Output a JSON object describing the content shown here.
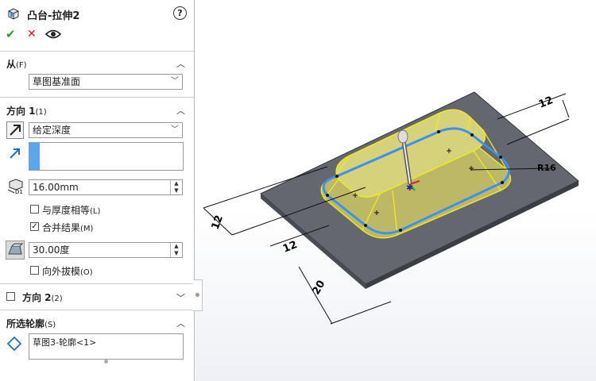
{
  "feature": {
    "title": "凸台-拉伸2",
    "help": "?"
  },
  "actions": {
    "ok": "✔",
    "cancel": "✕",
    "preview": "👁"
  },
  "from": {
    "label": "从",
    "shortcut": "(F)",
    "value": "草图基准面"
  },
  "direction1": {
    "label": "方向 1",
    "shortcut": "(1)",
    "end_condition": "给定深度",
    "depth_value": "16.00mm",
    "equal_thickness_label": "与厚度相等",
    "equal_thickness_shortcut": "(L)",
    "merge_label": "合并结果",
    "merge_shortcut": "(M)",
    "merge_checked": "✓",
    "draft_value": "30.00度",
    "draft_outward_label": "向外拔模",
    "draft_outward_shortcut": "(O)"
  },
  "direction2": {
    "label": "方向 2",
    "shortcut": "(2)"
  },
  "contours": {
    "label": "所选轮廓",
    "shortcut": "(S)",
    "item": "草图3-轮廓<1>"
  },
  "dimensions": {
    "top_12": "12",
    "left_12": "12",
    "mid_12": "12",
    "bottom_20": "20",
    "radius": "R16"
  },
  "colors": {
    "plate": "#646670",
    "boss": "#c9c56a",
    "edge_yellow": "#f1ea1c",
    "sketch_blue": "#3d8ff0",
    "accept_green": "#2a9a2a",
    "cancel_red": "#cc2222"
  }
}
